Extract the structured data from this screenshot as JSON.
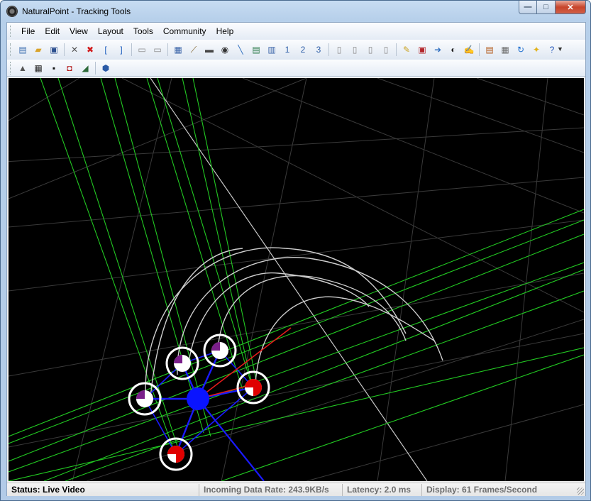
{
  "window": {
    "title": "NaturalPoint - Tracking Tools",
    "controls": {
      "minimize": "—",
      "maximize": "□",
      "close": "✕"
    }
  },
  "menubar": {
    "items": [
      {
        "label": "File"
      },
      {
        "label": "Edit"
      },
      {
        "label": "View"
      },
      {
        "label": "Layout"
      },
      {
        "label": "Tools"
      },
      {
        "label": "Community"
      },
      {
        "label": "Help"
      }
    ]
  },
  "toolbar_main": {
    "buttons": [
      {
        "icon": "new-project-icon",
        "glyph": "▤",
        "color": "#3d6fb0"
      },
      {
        "icon": "open-folder-icon",
        "glyph": "▰",
        "color": "#d9a32a"
      },
      {
        "icon": "save-icon",
        "glyph": "▣",
        "color": "#2c4f8f"
      },
      {
        "sep": true
      },
      {
        "icon": "tools-icon",
        "glyph": "✕",
        "color": "#555555"
      },
      {
        "icon": "delete-icon",
        "glyph": "✖",
        "color": "#d11a1a"
      },
      {
        "icon": "bracket-left-icon",
        "glyph": "[",
        "color": "#1f5fbf"
      },
      {
        "icon": "bracket-right-icon",
        "glyph": "]",
        "color": "#1f5fbf"
      },
      {
        "sep": true
      },
      {
        "icon": "layout-a-icon",
        "glyph": "▭",
        "color": "#8a8a8a"
      },
      {
        "icon": "layout-b-icon",
        "glyph": "▭",
        "color": "#8a8a8a"
      },
      {
        "sep": true
      },
      {
        "icon": "monitor-icon",
        "glyph": "▦",
        "color": "#3a64a8"
      },
      {
        "icon": "wand-icon",
        "glyph": "⟋",
        "color": "#7a5a20"
      },
      {
        "icon": "camera-strip-icon",
        "glyph": "▬",
        "color": "#444444"
      },
      {
        "icon": "record-icon",
        "glyph": "◉",
        "color": "#333333"
      },
      {
        "icon": "calibration-wand-icon",
        "glyph": "╲",
        "color": "#2f6fbf"
      },
      {
        "icon": "waveform-icon",
        "glyph": "▤",
        "color": "#2b7a4a"
      },
      {
        "icon": "export-icon",
        "glyph": "▥",
        "color": "#3a64a8"
      },
      {
        "icon": "view-1-icon",
        "glyph": "1",
        "color": "#2f5fa8"
      },
      {
        "icon": "view-2-icon",
        "glyph": "2",
        "color": "#2f5fa8"
      },
      {
        "icon": "view-3-icon",
        "glyph": "3",
        "color": "#2f5fa8"
      },
      {
        "sep": true
      },
      {
        "icon": "pane-1-icon",
        "glyph": "▯",
        "color": "#888888"
      },
      {
        "icon": "pane-2-icon",
        "glyph": "▯",
        "color": "#888888"
      },
      {
        "icon": "pane-3-icon",
        "glyph": "▯",
        "color": "#888888"
      },
      {
        "icon": "pane-4-icon",
        "glyph": "▯",
        "color": "#888888"
      },
      {
        "sep": true
      },
      {
        "icon": "notes-icon",
        "glyph": "✎",
        "color": "#c9a21f"
      },
      {
        "icon": "display-icon",
        "glyph": "▣",
        "color": "#b3262b"
      },
      {
        "icon": "document-export-icon",
        "glyph": "➜",
        "color": "#2f6fbf"
      },
      {
        "icon": "community-icon",
        "glyph": "◐",
        "color": "#222222"
      },
      {
        "icon": "edit-document-icon",
        "glyph": "✍",
        "color": "#8a6a20"
      },
      {
        "sep": true
      },
      {
        "icon": "properties-icon",
        "glyph": "▤",
        "color": "#b35a1a"
      },
      {
        "icon": "calendar-icon",
        "glyph": "▦",
        "color": "#6a6a6a"
      },
      {
        "icon": "refresh-icon",
        "glyph": "↻",
        "color": "#1f6fcf"
      },
      {
        "icon": "lightbulb-icon",
        "glyph": "✦",
        "color": "#e2b21c"
      },
      {
        "icon": "help-icon",
        "glyph": "?",
        "color": "#2356b8"
      }
    ]
  },
  "toolbar_view": {
    "buttons": [
      {
        "icon": "perspective-icon",
        "glyph": "▲",
        "color": "#555555"
      },
      {
        "icon": "grid-icon",
        "glyph": "▦",
        "color": "#222222"
      },
      {
        "icon": "select-camera-icon",
        "glyph": "▪",
        "color": "#111111"
      },
      {
        "icon": "camera-red-icon",
        "glyph": "◘",
        "color": "#b31818"
      },
      {
        "icon": "floor-icon",
        "glyph": "◢",
        "color": "#2e6a3a"
      },
      {
        "sep": true
      },
      {
        "icon": "marker-hexagon-icon",
        "glyph": "⬢",
        "color": "#2a5aa6"
      }
    ]
  },
  "statusbar": {
    "status": "Status: Live Video",
    "data_rate": "Incoming Data Rate: 243.9KB/s",
    "latency": "Latency: 2.0 ms",
    "display": "Display: 61 Frames/Second"
  },
  "scene": {
    "background": "#000000",
    "grid_color": "#3a3a3a",
    "ray_color": "#22c922",
    "trajectory_color": "#cfcfcf",
    "bone_color": "#1a1aff",
    "axis_color": "#e31b1b",
    "pivot_color": "#0a14ff"
  }
}
